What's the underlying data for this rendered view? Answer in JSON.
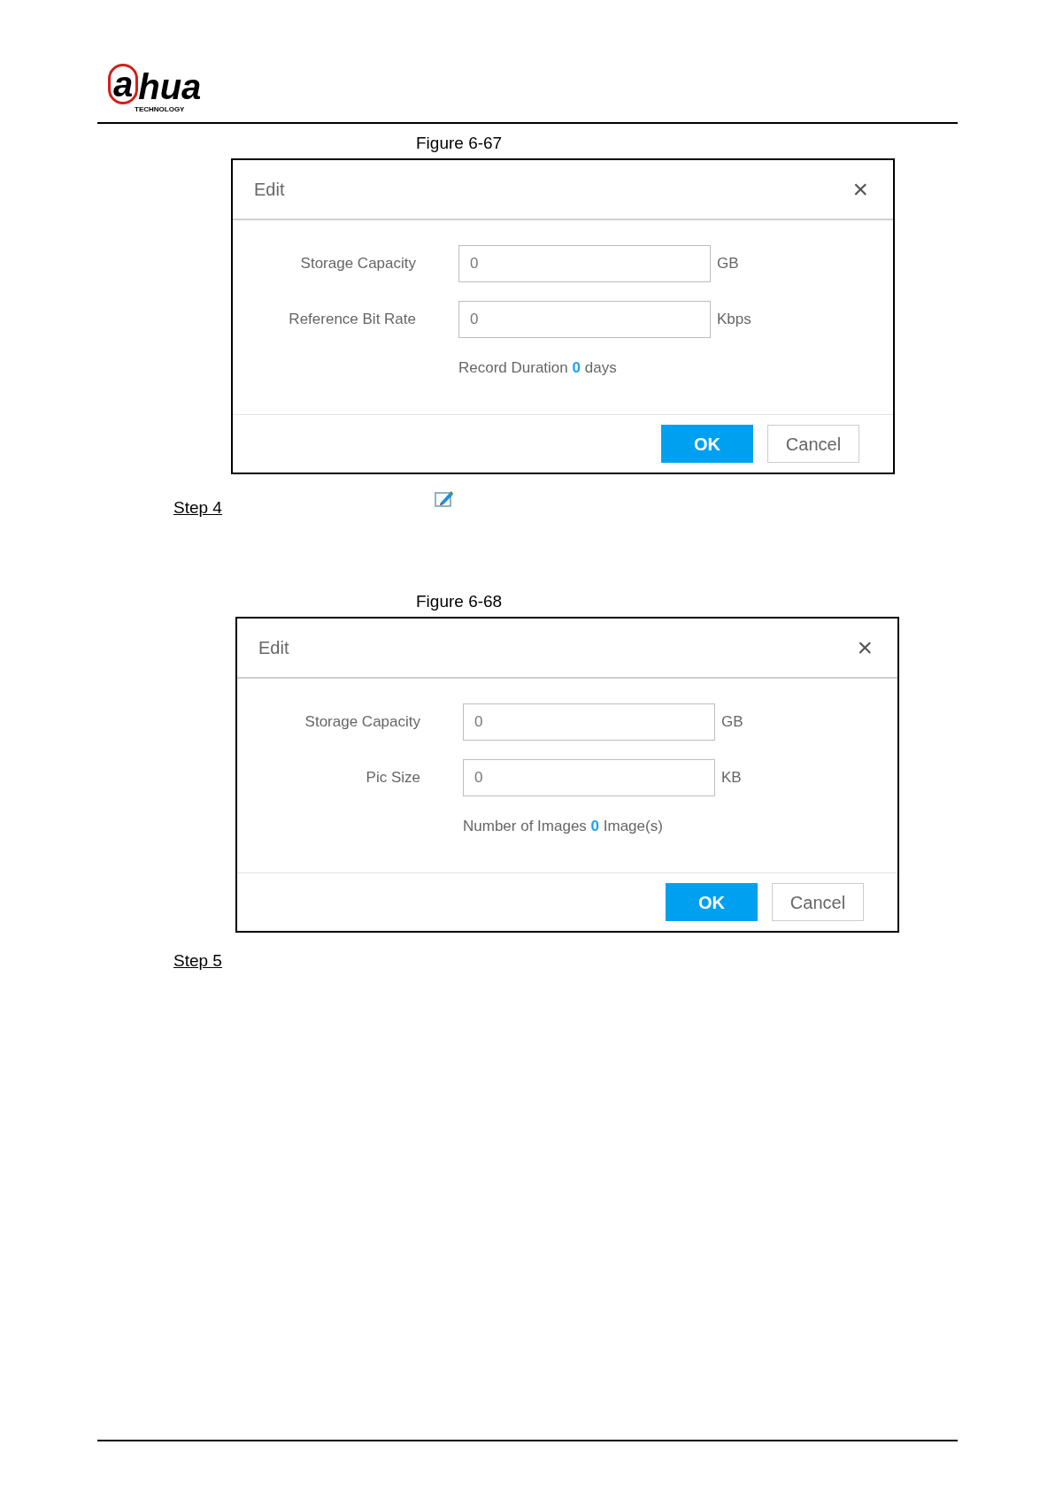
{
  "header": {
    "logo": {
      "lead": "a",
      "main": "hua",
      "tagline": "TECHNOLOGY"
    }
  },
  "figures": [
    {
      "caption": "Figure 6-67",
      "dialog": {
        "title": "Edit",
        "close": "×",
        "fields": [
          {
            "label": "Storage Capacity",
            "value": "0",
            "unit": "GB"
          },
          {
            "label": "Reference Bit Rate",
            "value": "0",
            "unit": "Kbps"
          }
        ],
        "summary": {
          "prefix": "Record Duration",
          "value": "0",
          "suffix": "days"
        },
        "buttons": [
          {
            "label": "OK",
            "kind": "primary"
          },
          {
            "label": "Cancel",
            "kind": "secondary"
          }
        ]
      },
      "step": {
        "label": "Step 4",
        "icon": true
      }
    },
    {
      "caption": "Figure 6-68",
      "dialog": {
        "title": "Edit",
        "close": "×",
        "fields": [
          {
            "label": "Storage Capacity",
            "value": "0",
            "unit": "GB"
          },
          {
            "label": "Pic Size",
            "value": "0",
            "unit": "KB"
          }
        ],
        "summary": {
          "prefix": "Number of Images",
          "value": "0",
          "suffix": "Image(s)"
        },
        "buttons": [
          {
            "label": "OK",
            "kind": "primary"
          },
          {
            "label": "Cancel",
            "kind": "secondary"
          }
        ]
      },
      "step": {
        "label": "Step 5",
        "icon": false
      }
    }
  ]
}
